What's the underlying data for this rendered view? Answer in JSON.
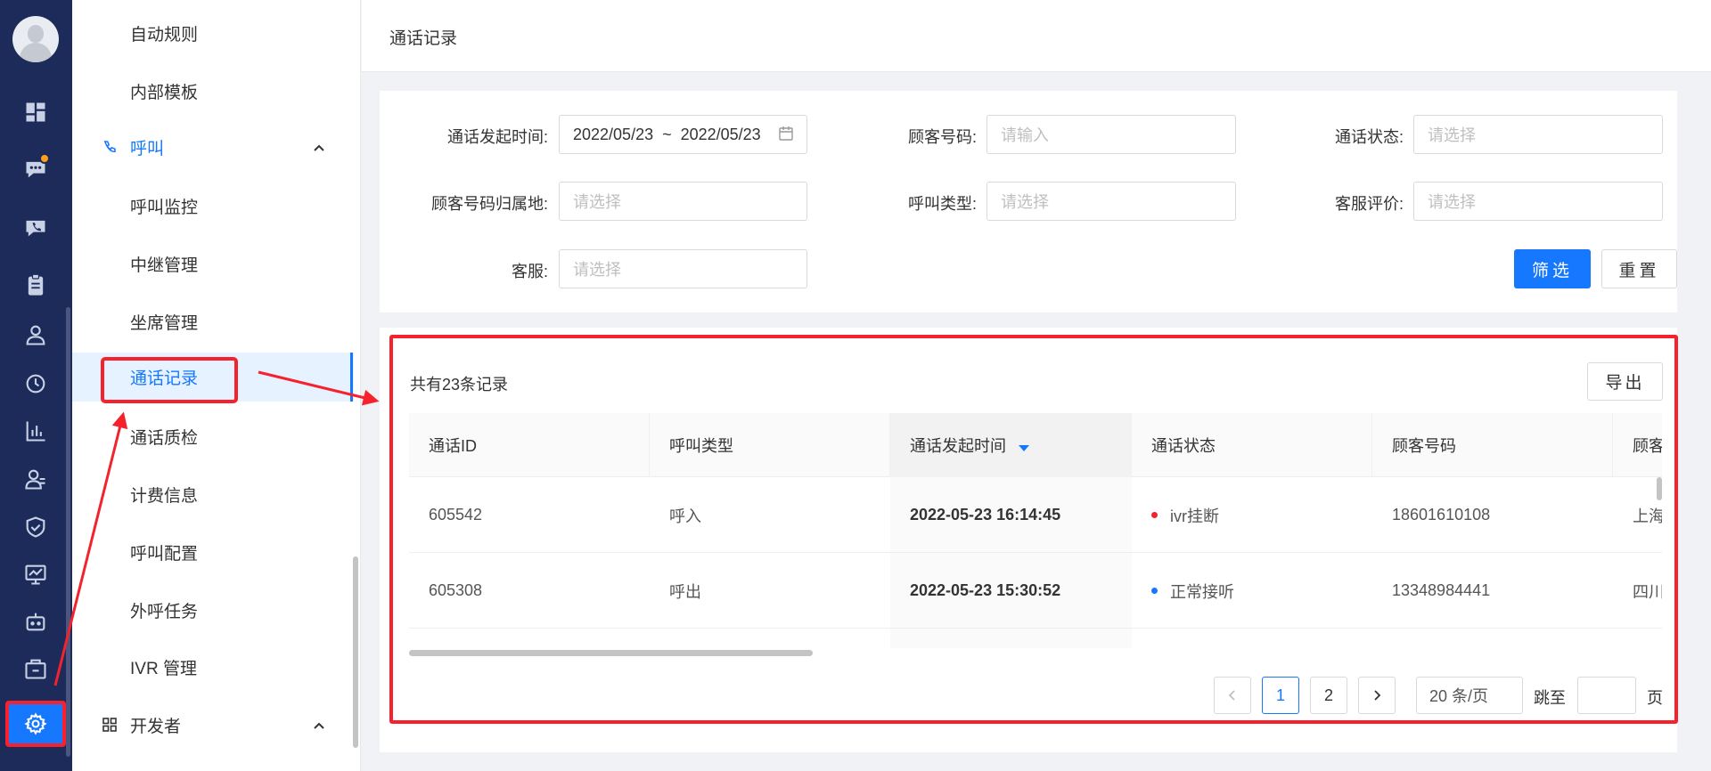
{
  "rail": {
    "icons": [
      "dashboard-icon",
      "chat-icon",
      "phone-icon",
      "clipboard-icon",
      "user-icon",
      "history-icon",
      "bar-chart-icon",
      "team-icon",
      "shield-icon",
      "monitor-icon",
      "robot-icon",
      "app-icon",
      "settings-icon"
    ]
  },
  "submenu": {
    "items_top": [
      {
        "label": "自动规则"
      },
      {
        "label": "内部模板"
      }
    ],
    "group_call": {
      "label": "呼叫"
    },
    "items_call": [
      {
        "label": "呼叫监控"
      },
      {
        "label": "中继管理"
      },
      {
        "label": "坐席管理"
      },
      {
        "label": "通话记录"
      },
      {
        "label": "通话质检"
      },
      {
        "label": "计费信息"
      },
      {
        "label": "呼叫配置"
      },
      {
        "label": "外呼任务"
      },
      {
        "label": "IVR 管理"
      }
    ],
    "group_dev": {
      "label": "开发者"
    }
  },
  "page": {
    "title": "通话记录"
  },
  "filters": {
    "call_time_label": "通话发起时间:",
    "call_time_value": "2022/05/23  ~  2022/05/23",
    "customer_number_label": "顾客号码:",
    "customer_number_placeholder": "请输入",
    "call_status_label": "通话状态:",
    "call_status_placeholder": "请选择",
    "number_region_label": "顾客号码归属地:",
    "number_region_placeholder": "请选择",
    "call_type_label": "呼叫类型:",
    "call_type_placeholder": "请选择",
    "rating_label": "客服评价:",
    "rating_placeholder": "请选择",
    "agent_label": "客服:",
    "agent_placeholder": "请选择",
    "filter_button": "筛选",
    "reset_button": "重置"
  },
  "table": {
    "total_text": "共有23条记录",
    "export_button": "导出",
    "columns": [
      "通话ID",
      "呼叫类型",
      "通话发起时间",
      "通话状态",
      "顾客号码",
      "顾客"
    ],
    "rows": [
      {
        "id": "605542",
        "type": "呼入",
        "time": "2022-05-23 16:14:45",
        "status": "ivr挂断",
        "status_color": "#f5222d",
        "number": "18601610108",
        "region": "上海"
      },
      {
        "id": "605308",
        "type": "呼出",
        "time": "2022-05-23 15:30:52",
        "status": "正常接听",
        "status_color": "#1677ff",
        "number": "13348984441",
        "region": "四川"
      }
    ]
  },
  "pagination": {
    "pages": [
      "1",
      "2"
    ],
    "current_page": "1",
    "page_size": "20 条/页",
    "jump_label": "跳至",
    "page_unit": "页"
  },
  "colors": {
    "accent": "#1677ff",
    "highlight": "#f5222d",
    "rail": "#1c2b5a"
  }
}
